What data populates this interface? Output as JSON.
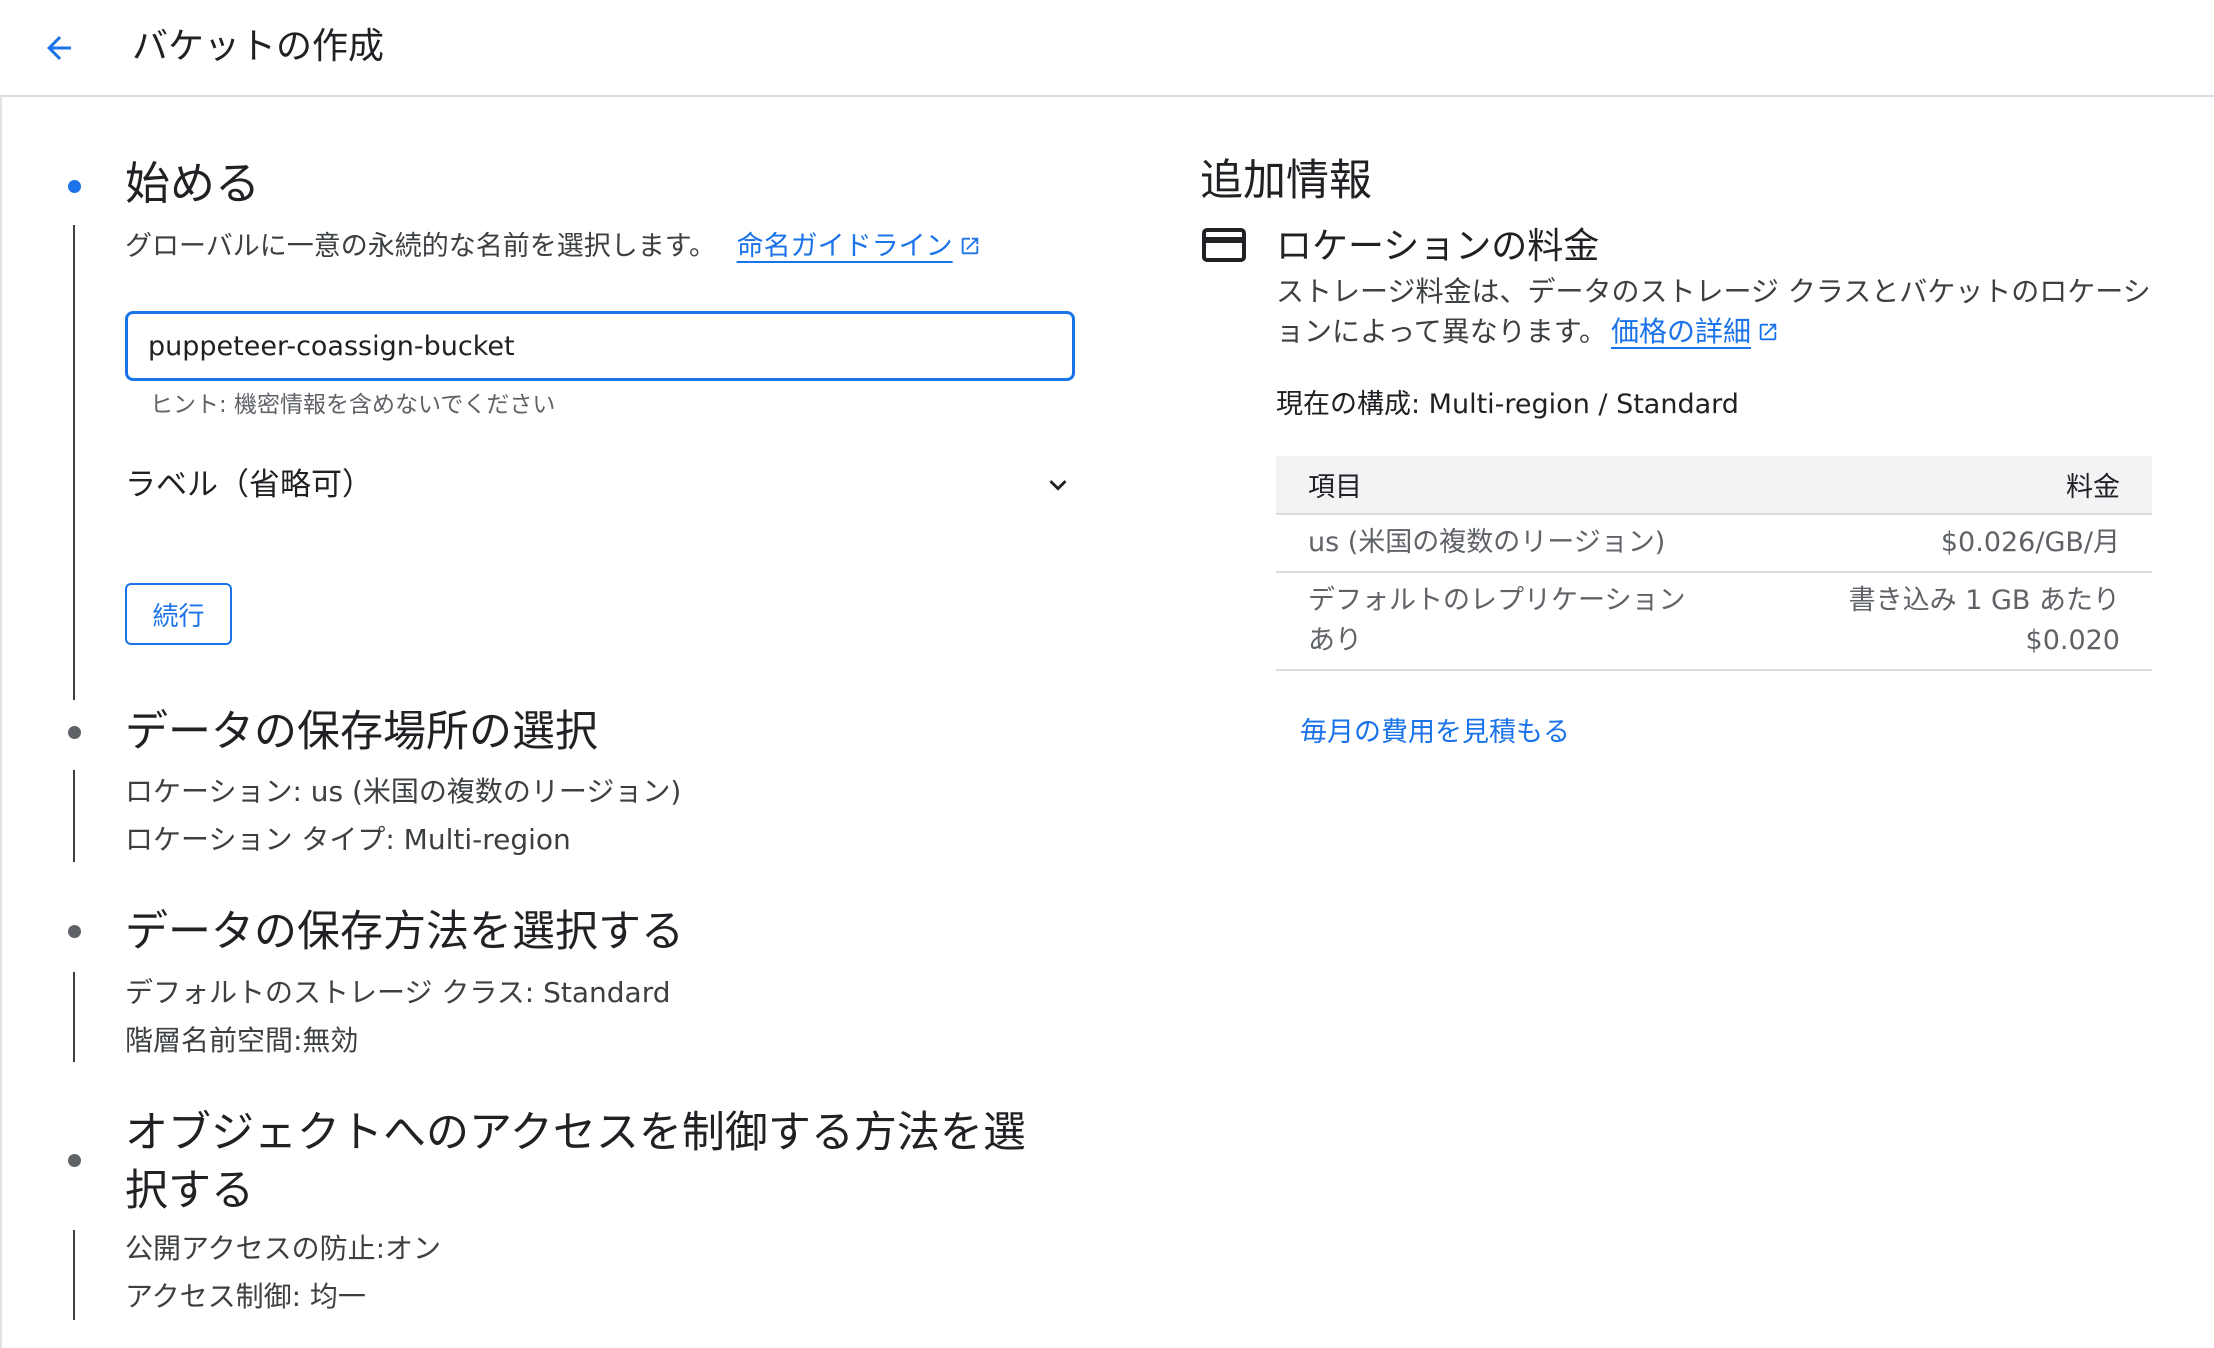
{
  "header": {
    "title": "バケットの作成"
  },
  "steps": {
    "start": {
      "title": "始める",
      "description": "グローバルに一意の永続的な名前を選択します。",
      "guide_link": "命名ガイドライン",
      "input_value": "puppeteer-coassign-bucket",
      "hint": "ヒント: 機密情報を含めないでください",
      "labels_toggle": "ラベル（省略可）",
      "continue_label": "続行"
    },
    "location": {
      "title": "データの保存場所の選択",
      "line1": "ロケーション: us (米国の複数のリージョン)",
      "line2": "ロケーション タイプ: Multi-region"
    },
    "storage": {
      "title": "データの保存方法を選択する",
      "line1": "デフォルトのストレージ クラス: Standard",
      "line2": "階層名前空間:無効"
    },
    "access": {
      "title_line1": "オブジェクトへのアクセスを制御する方法を選",
      "title_line2": "択する",
      "line1": "公開アクセスの防止:オン",
      "line2": "アクセス制御: 均一"
    }
  },
  "info": {
    "title": "追加情報",
    "section_title": "ロケーションの料金",
    "desc_line1": "ストレージ料金は、データのストレージ クラスとバケットのロケーシ",
    "desc_line2": "ョンによって異なります。",
    "price_link": "価格の詳細",
    "current_config": "現在の構成: Multi-region / Standard",
    "table": {
      "headers": {
        "item": "項目",
        "price": "料金"
      },
      "rows": [
        {
          "item_line1": "us (米国の複数のリージョン)",
          "item_line2": "",
          "price_line1": "$0.026/GB/月",
          "price_line2": ""
        },
        {
          "item_line1": "デフォルトのレプリケーション",
          "item_line2": "あり",
          "price_line1": "書き込み 1 GB あたり",
          "price_line2": "$0.020"
        }
      ]
    },
    "estimate_link": "毎月の費用を見積もる"
  },
  "colors": {
    "accent": "#1a73e8",
    "text": "#202124",
    "muted": "#5f6368"
  }
}
